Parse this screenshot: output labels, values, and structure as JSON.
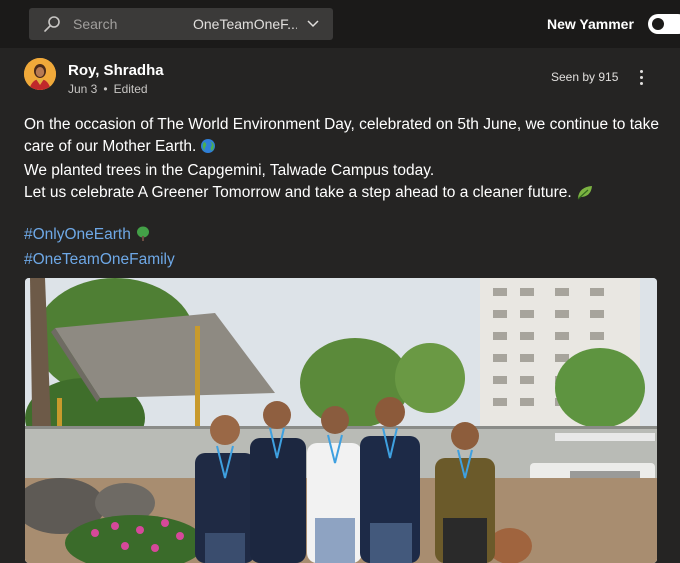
{
  "header": {
    "search_placeholder": "Search",
    "search_scope": "OneTeamOneF...",
    "toggle_label": "New Yammer",
    "toggle_on": true
  },
  "post": {
    "author": "Roy, Shradha",
    "date": "Jun 3",
    "edited": "Edited",
    "seen_by": "Seen by 915",
    "lines": [
      "On the occasion of The World Environment Day, celebrated on 5th June, we continue to take care of our Mother Earth.",
      "We planted trees in the Capgemini, Talwade Campus today.",
      "Let us celebrate A Greener Tomorrow and take a step ahead to a cleaner future."
    ],
    "tags": [
      "#OnlyOneEarth",
      "#OneTeamOneFamily"
    ]
  },
  "icons": {
    "search": "search-icon",
    "chevron": "chevron-down-icon",
    "more": "more-options-icon",
    "globe": "globe-emoji",
    "leaf": "leaf-emoji",
    "tree": "tree-emoji"
  },
  "colors": {
    "background": "#1b1a19",
    "card": "#252423",
    "link": "#6ea8e6",
    "search_box": "#3b3a39"
  }
}
